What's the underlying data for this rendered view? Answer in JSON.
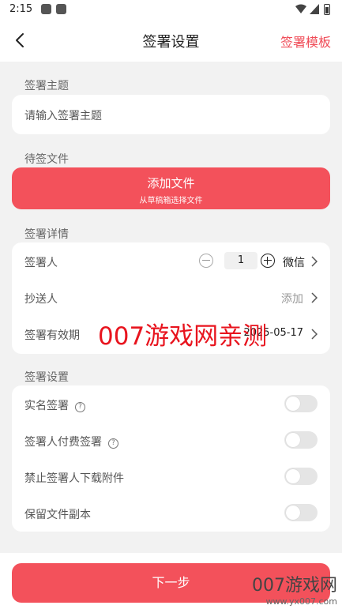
{
  "status_bar": {
    "time": "2:15"
  },
  "nav": {
    "title": "签署设置",
    "template_link": "签署模板"
  },
  "sections": {
    "subject": {
      "label": "签署主题",
      "placeholder": "请输入签署主题"
    },
    "file": {
      "label": "待签文件",
      "add_button": "添加文件",
      "add_hint": "从草稿箱选择文件"
    },
    "details": {
      "label": "签署详情",
      "signer": {
        "label": "签署人",
        "quantity": "1",
        "method": "微信"
      },
      "cc": {
        "label": "抄送人",
        "value": "添加"
      },
      "validity": {
        "label": "签署有效期",
        "value": "2025-05-17"
      }
    },
    "settings": {
      "label": "签署设置",
      "items": [
        {
          "label": "实名签署",
          "help": "?"
        },
        {
          "label": "签署人付费签署",
          "help": "?"
        },
        {
          "label": "禁止签署人下载附件"
        },
        {
          "label": "保留文件副本"
        }
      ]
    }
  },
  "bottom": {
    "next_button": "下一步"
  },
  "watermark": {
    "overlay": "007游戏网亲测",
    "brand": "007游戏网",
    "url": "www.yx007.com"
  }
}
